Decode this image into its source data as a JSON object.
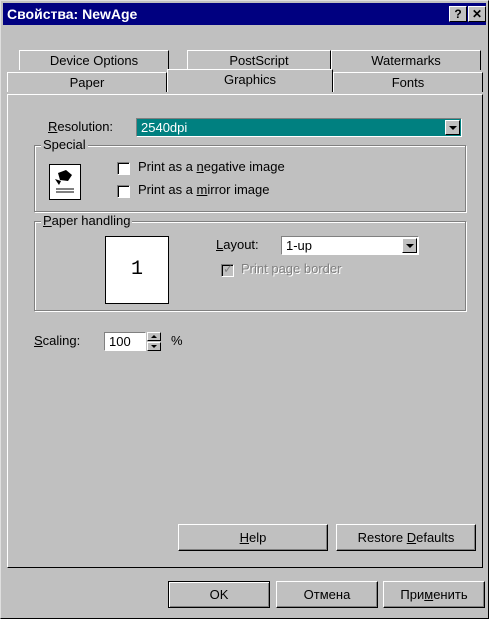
{
  "window": {
    "title": "Свойства: NewAge",
    "help_btn": "?",
    "close_btn": "✕"
  },
  "tabs_back": [
    "Device Options",
    "PostScript",
    "Watermarks"
  ],
  "tabs_front": [
    "Paper",
    "Graphics",
    "Fonts"
  ],
  "active_tab": "Graphics",
  "resolution": {
    "label_pre": "",
    "label_u": "R",
    "label_post": "esolution:",
    "value": "2540dpi"
  },
  "special": {
    "legend": "Special",
    "neg": {
      "pre": "Print as a ",
      "u": "n",
      "post": "egative image",
      "checked": false
    },
    "mirror": {
      "pre": "Print as a ",
      "u": "m",
      "post": "irror image",
      "checked": false
    }
  },
  "paper_handling": {
    "legend_u": "P",
    "legend_post": "aper handling",
    "preview_number": "1",
    "layout_u": "L",
    "layout_post": "ayout:",
    "layout_value": "1-up",
    "border_label": "Print page border",
    "border_checked": true
  },
  "scaling": {
    "label_u": "S",
    "label_post": "caling:",
    "value": "100",
    "unit": "%"
  },
  "panel_buttons": {
    "help_u": "H",
    "help_post": "elp",
    "restore_pre": "Restore ",
    "restore_u": "D",
    "restore_post": "efaults"
  },
  "dialog_buttons": {
    "ok": "OK",
    "cancel": "Отмена",
    "apply_pre": "При",
    "apply_u": "м",
    "apply_post": "енить"
  }
}
